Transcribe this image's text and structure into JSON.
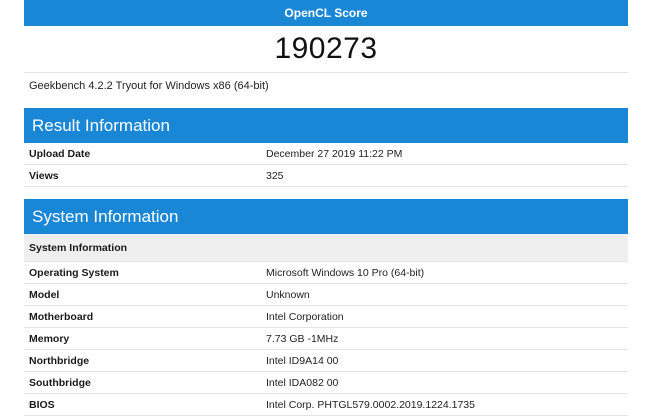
{
  "score": {
    "header": "OpenCL Score",
    "value": "190273"
  },
  "version_line": "Geekbench 4.2.2 Tryout for Windows x86 (64-bit)",
  "result_info": {
    "title": "Result Information",
    "rows": [
      {
        "key": "Upload Date",
        "value": "December 27 2019 11:22 PM"
      },
      {
        "key": "Views",
        "value": "325"
      }
    ]
  },
  "system_info": {
    "title": "System Information",
    "subheader": "System Information",
    "rows": [
      {
        "key": "Operating System",
        "value": "Microsoft Windows 10 Pro (64-bit)"
      },
      {
        "key": "Model",
        "value": "Unknown"
      },
      {
        "key": "Motherboard",
        "value": "Intel Corporation"
      },
      {
        "key": "Memory",
        "value": "7.73 GB -1MHz"
      },
      {
        "key": "Northbridge",
        "value": "Intel ID9A14 00"
      },
      {
        "key": "Southbridge",
        "value": "Intel IDA082 00"
      },
      {
        "key": "BIOS",
        "value": "Intel Corp. PHTGL579.0002.2019.1224.1735"
      }
    ]
  },
  "colors": {
    "header_blue": "#1a87d6",
    "subheader_gray": "#efefef"
  }
}
